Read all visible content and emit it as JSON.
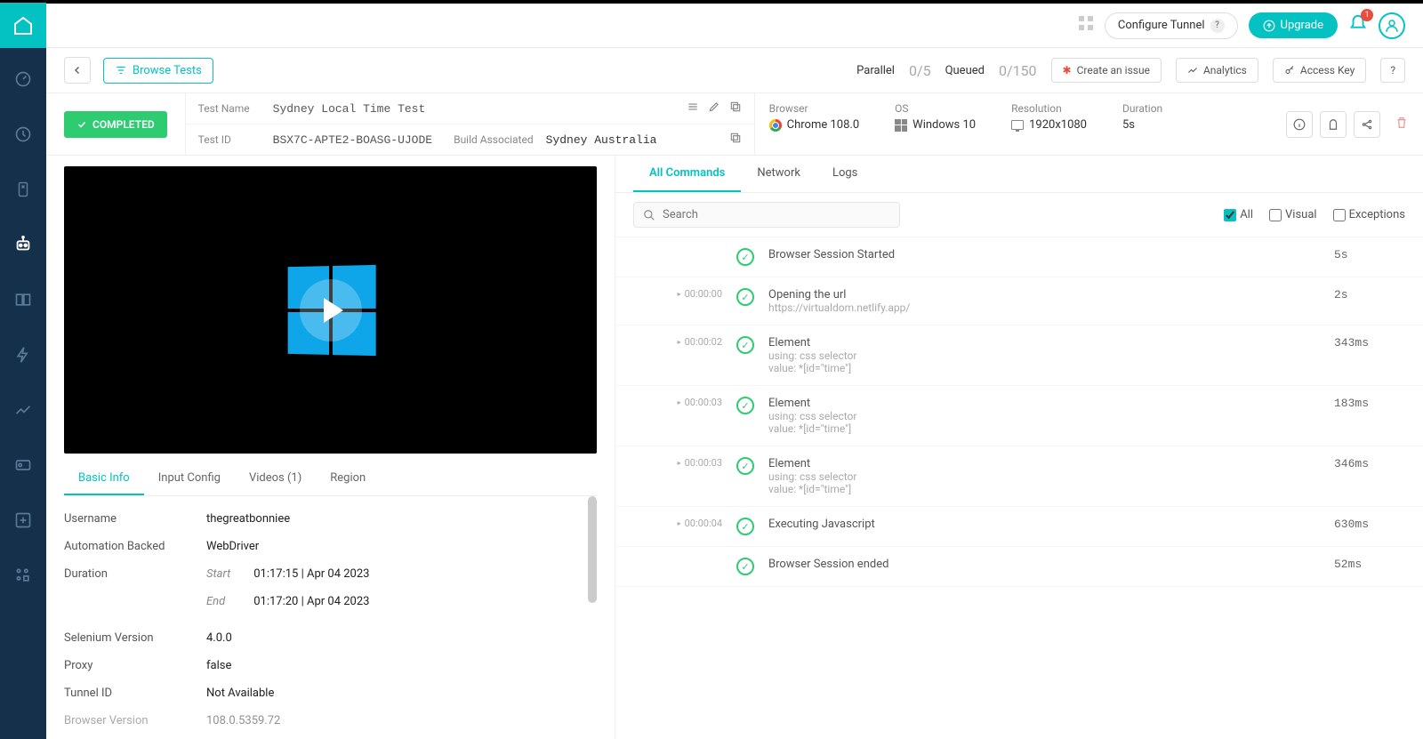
{
  "header": {
    "configure_tunnel": "Configure Tunnel",
    "upgrade": "Upgrade",
    "notif_count": "1"
  },
  "toolbar": {
    "browse_tests": "Browse Tests",
    "parallel_label": "Parallel",
    "parallel_val": "0/5",
    "queued_label": "Queued",
    "queued_val": "0/150",
    "create_issue": "Create an issue",
    "analytics": "Analytics",
    "access_key": "Access Key",
    "help": "?"
  },
  "status": {
    "completed": "COMPLETED"
  },
  "meta": {
    "test_name_label": "Test Name",
    "test_name": "Sydney Local Time Test",
    "test_id_label": "Test ID",
    "test_id": "BSX7C-APTE2-BOASG-UJODE",
    "build_label": "Build Associated",
    "build": "Sydney Australia"
  },
  "env": {
    "browser_label": "Browser",
    "browser": "Chrome 108.0",
    "os_label": "OS",
    "os": "Windows 10",
    "resolution_label": "Resolution",
    "resolution": "1920x1080",
    "duration_label": "Duration",
    "duration": "5s"
  },
  "left_tabs": {
    "basic": "Basic Info",
    "input": "Input Config",
    "videos": "Videos (1)",
    "region": "Region"
  },
  "info": {
    "username_k": "Username",
    "username_v": "thegreatbonniee",
    "autobacked_k": "Automation Backed",
    "autobacked_v": "WebDriver",
    "duration_k": "Duration",
    "start_l": "Start",
    "start_v": "01:17:15 | Apr 04 2023",
    "end_l": "End",
    "end_v": "01:17:20 | Apr 04 2023",
    "selver_k": "Selenium Version",
    "selver_v": "4.0.0",
    "proxy_k": "Proxy",
    "proxy_v": "false",
    "tunnel_k": "Tunnel ID",
    "tunnel_v": "Not Available",
    "brver_k": "Browser Version",
    "brver_v": "108.0.5359.72"
  },
  "right_tabs": {
    "all": "All Commands",
    "network": "Network",
    "logs": "Logs"
  },
  "search": {
    "placeholder": "Search"
  },
  "filters": {
    "all": "All",
    "visual": "Visual",
    "exceptions": "Exceptions"
  },
  "commands": [
    {
      "time": "",
      "title": "Browser Session Started",
      "sub": "",
      "dur": "5s"
    },
    {
      "time": "00:00:00",
      "title": "Opening the url",
      "sub": "https://virtualdom.netlify.app/",
      "dur": "2s"
    },
    {
      "time": "00:00:02",
      "title": "Element",
      "sub": "using: css selector\nvalue: *[id=\"time\"]",
      "dur": "343ms"
    },
    {
      "time": "00:00:03",
      "title": "Element",
      "sub": "using: css selector\nvalue: *[id=\"time\"]",
      "dur": "183ms"
    },
    {
      "time": "00:00:03",
      "title": "Element",
      "sub": "using: css selector\nvalue: *[id=\"time\"]",
      "dur": "346ms"
    },
    {
      "time": "00:00:04",
      "title": "Executing Javascript",
      "sub": "",
      "dur": "630ms"
    },
    {
      "time": "",
      "title": "Browser Session ended",
      "sub": "",
      "dur": "52ms"
    }
  ]
}
